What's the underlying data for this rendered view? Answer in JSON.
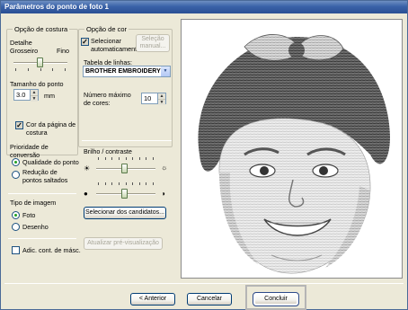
{
  "window": {
    "title": "Parâmetros do ponto de foto 1"
  },
  "sewing": {
    "legend": "Opção de costura",
    "detail_label": "Detalhe",
    "coarse_label": "Grosseiro",
    "fine_label": "Fino",
    "stitch_size_label": "Tamanho do ponto",
    "stitch_size_value": "3.0",
    "stitch_size_unit": "mm",
    "page_color_label": "Cor da página de costura",
    "priority_label": "Prioridade de conversão",
    "priority_quality": "Qualidade do ponto",
    "priority_reduce": "Redução de pontos saltados",
    "image_type_label": "Tipo de imagem",
    "image_photo": "Foto",
    "image_drawing": "Desenho",
    "mask_outline_label": "Adic. cont. de másc."
  },
  "color": {
    "legend": "Opção de cor",
    "auto_select_label": "Selecionar automaticamente",
    "manual_select_button": "Seleção manual...",
    "thread_table_label": "Tabela de linhas:",
    "thread_table_value": "BROTHER EMBROIDERY",
    "max_colors_label": "Número máximo de cores:",
    "max_colors_value": "10",
    "brightness_label": "Brilho / contraste",
    "select_candidates_button": "Selecionar dos candidatos...",
    "update_preview_button": "Atualizar pré-visualização"
  },
  "footer": {
    "back_button": "< Anterior",
    "cancel_button": "Cancelar",
    "finish_button": "Concluir"
  },
  "colors": {
    "title_bar": "#3a62a8",
    "dialog_bg": "#ece9d8",
    "check_green": "#21a121"
  }
}
